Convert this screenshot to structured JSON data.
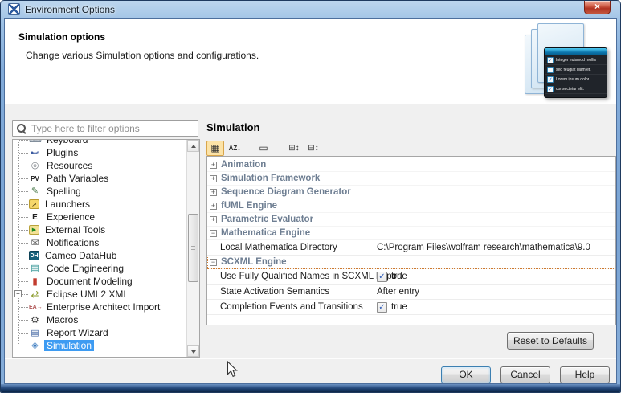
{
  "window": {
    "title": "Environment Options"
  },
  "banner": {
    "title": "Simulation options",
    "subtitle": "Change various Simulation options and configurations.",
    "checklist": [
      {
        "label": "Integer euismod mollis",
        "checked": true
      },
      {
        "label": "sed feugiat diam et.",
        "checked": false
      },
      {
        "label": "Lorem ipsum dolor",
        "checked": true
      },
      {
        "label": "consectetur elit.",
        "checked": true
      }
    ]
  },
  "sidebar": {
    "filter_placeholder": "Type here to filter options",
    "items": [
      {
        "label": "Keyboard",
        "icon": "keyboard-icon"
      },
      {
        "label": "Plugins",
        "icon": "plugins-icon"
      },
      {
        "label": "Resources",
        "icon": "resources-icon"
      },
      {
        "label": "Path Variables",
        "icon": "path-variables-icon"
      },
      {
        "label": "Spelling",
        "icon": "spelling-icon"
      },
      {
        "label": "Launchers",
        "icon": "launchers-icon"
      },
      {
        "label": "Experience",
        "icon": "experience-icon"
      },
      {
        "label": "External Tools",
        "icon": "external-tools-icon"
      },
      {
        "label": "Notifications",
        "icon": "notifications-icon"
      },
      {
        "label": "Cameo DataHub",
        "icon": "cameo-datahub-icon"
      },
      {
        "label": "Code Engineering",
        "icon": "code-engineering-icon"
      },
      {
        "label": "Document Modeling",
        "icon": "document-modeling-icon"
      },
      {
        "label": "Eclipse UML2 XMI",
        "icon": "eclipse-uml2-xmi-icon",
        "expandable": true
      },
      {
        "label": "Enterprise Architect Import",
        "icon": "enterprise-architect-import-icon"
      },
      {
        "label": "Macros",
        "icon": "macros-icon"
      },
      {
        "label": "Report Wizard",
        "icon": "report-wizard-icon"
      },
      {
        "label": "Simulation",
        "icon": "simulation-icon",
        "selected": true
      }
    ]
  },
  "main": {
    "heading": "Simulation",
    "toolbar": [
      {
        "name": "categorized-view-button",
        "selected": true
      },
      {
        "name": "sort-alphabetically-button",
        "selected": false
      },
      {
        "name": "show-description-button",
        "selected": false
      },
      {
        "name": "expand-all-button",
        "selected": false
      },
      {
        "name": "collapse-all-button",
        "selected": false
      }
    ],
    "groups": [
      {
        "label": "Animation",
        "expanded": false
      },
      {
        "label": "Simulation Framework",
        "expanded": false
      },
      {
        "label": "Sequence Diagram Generator",
        "expanded": false
      },
      {
        "label": "fUML Engine",
        "expanded": false
      },
      {
        "label": "Parametric Evaluator",
        "expanded": false
      },
      {
        "label": "Mathematica Engine",
        "expanded": true,
        "rows": [
          {
            "label": "Local Mathematica Directory",
            "type": "text",
            "value": "C:\\Program Files\\wolfram research\\mathematica\\9.0"
          }
        ]
      },
      {
        "label": "SCXML Engine",
        "expanded": true,
        "focused": true,
        "rows": [
          {
            "label": "Use Fully Qualified Names in SCXML Export",
            "type": "checkbox",
            "checked": true,
            "value": "true"
          },
          {
            "label": "State Activation Semantics",
            "type": "text",
            "value": "After entry"
          },
          {
            "label": "Completion Events and Transitions",
            "type": "checkbox",
            "checked": true,
            "value": "true"
          }
        ]
      }
    ],
    "reset_label": "Reset to Defaults"
  },
  "footer": {
    "ok": "OK",
    "cancel": "Cancel",
    "help": "Help"
  },
  "colors": {
    "selection_blue": "#3d9bf2",
    "focus_orange": "#cf7a2e",
    "toolbar_selected": "#fce3a7",
    "titlebar_blue": "#7aa4d4",
    "group_header_text": "#6e7e92",
    "close_button_red": "#b13322"
  }
}
